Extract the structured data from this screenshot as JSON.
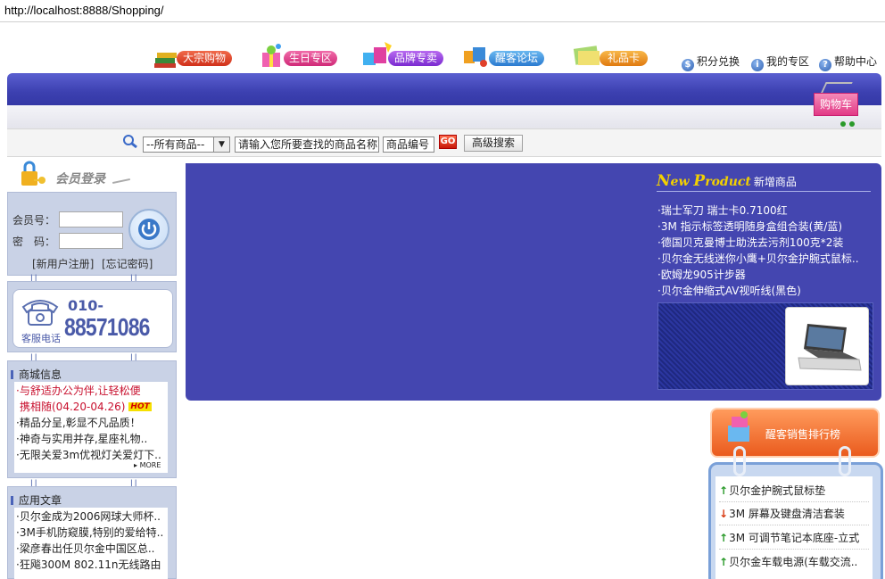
{
  "browser": {
    "url": "http://localhost:8888/Shopping/"
  },
  "topnav": {
    "items": [
      {
        "label": "大宗购物",
        "color": "#e0402a"
      },
      {
        "label": "生日专区",
        "color": "#e0307a"
      },
      {
        "label": "品牌专卖",
        "color": "#8a3ad8"
      },
      {
        "label": "醒客论坛",
        "color": "#2a8ee0"
      },
      {
        "label": "礼品卡",
        "color": "#e88a1a"
      }
    ],
    "links": [
      {
        "label": "积分兑换"
      },
      {
        "label": "我的专区"
      },
      {
        "label": "帮助中心"
      }
    ]
  },
  "cart": {
    "label": "购物车"
  },
  "search": {
    "category": "--所有商品--",
    "name_placeholder": "请输入您所要查找的商品名称",
    "code_placeholder": "商品编号",
    "go_label": "GO",
    "advanced_label": "高级搜索"
  },
  "login": {
    "title": "会员登录",
    "member_label": "会员号：",
    "password_label": "密　码：",
    "register_link": "[新用户注册]",
    "forgot_link": "[忘记密码]"
  },
  "phone": {
    "prefix": "010-",
    "number": "88571086",
    "caption": "客服电话"
  },
  "news": {
    "title": "商城信息",
    "items": [
      "与舒适办公为伴,让轻松便",
      "携相随(04.20-04.26)",
      "精品分呈,彰显不凡品质！",
      "神奇与实用并存,星座礼物..",
      "无限关爱3m优视灯关爱灯下.."
    ],
    "hot_label": "HOT",
    "more_label": "MORE"
  },
  "articles": {
    "title": "应用文章",
    "items": [
      "贝尔金成为2006网球大师杯..",
      "3M手机防窥膜,特别的爱给特..",
      "梁彦春出任贝尔金中国区总..",
      "狂飚300M 802.11n无线路由"
    ]
  },
  "new_products": {
    "title_en_1": "N",
    "title_en_2": "ew ",
    "title_en_3": "P",
    "title_en_4": "roduct",
    "title_cn": "新增商品",
    "items": [
      "瑞士军刀 瑞士卡0.7100红",
      "3M 指示标签透明随身盒组合装(黄/蓝)",
      "德国贝克曼博士助洗去污剂100克*2装",
      "贝尔金无线迷你小鹰+贝尔金护腕式鼠标..",
      "欧姆龙905计步器",
      "贝尔金伸缩式AV视听线(黑色)"
    ]
  },
  "ranking": {
    "title": "醒客销售排行榜",
    "items": [
      {
        "trend": "up",
        "text": "贝尔金护腕式鼠标垫"
      },
      {
        "trend": "down",
        "text": "3M 屏幕及键盘清洁套装"
      },
      {
        "trend": "up",
        "text": "3M 可调节笔记本底座-立式"
      },
      {
        "trend": "up",
        "text": "贝尔金车载电源(车载交流.."
      }
    ]
  }
}
